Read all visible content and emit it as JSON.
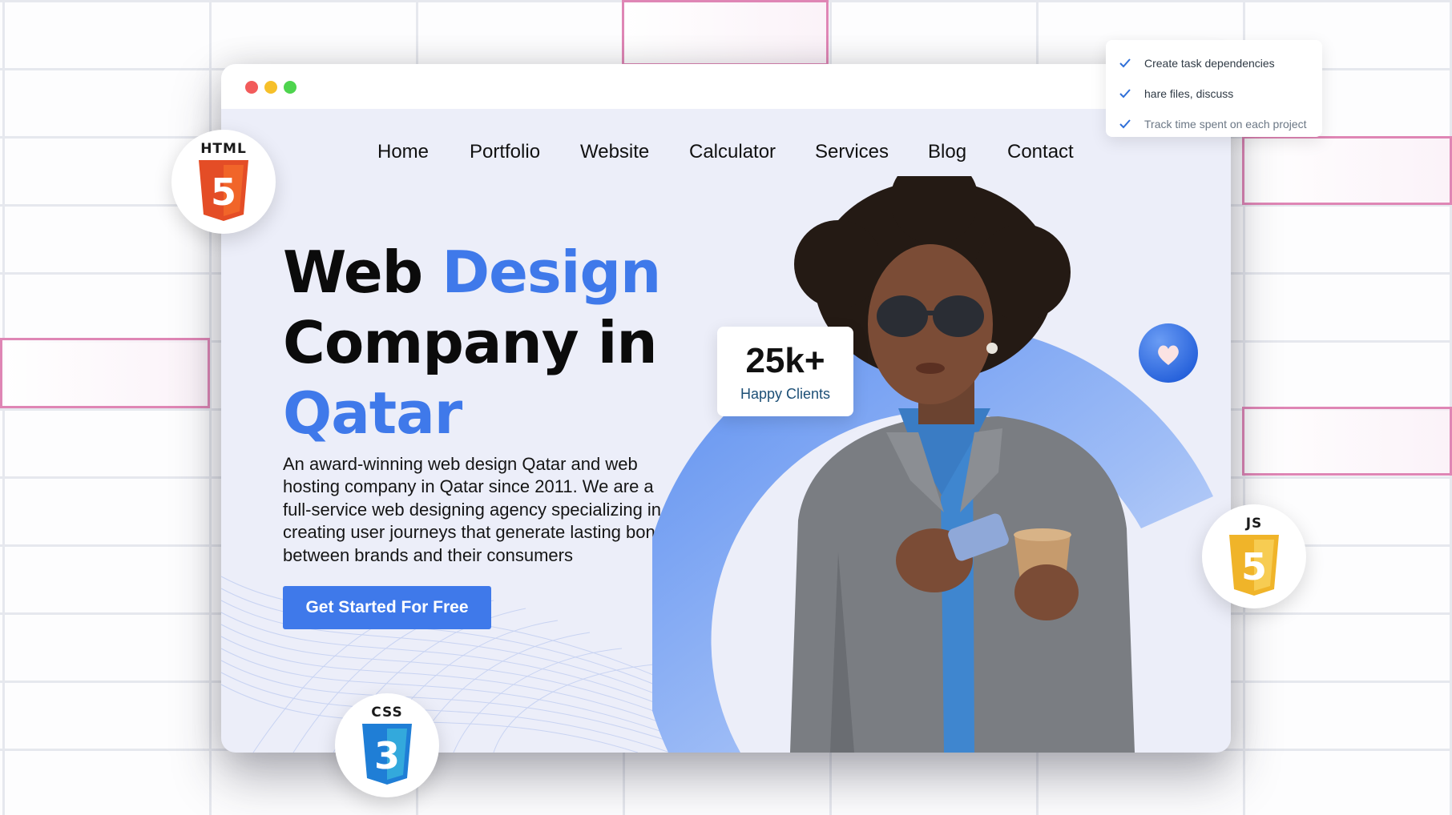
{
  "checklist": {
    "items": [
      {
        "label": "Create task dependencies"
      },
      {
        "label": "hare files, discuss"
      },
      {
        "label": "Track time spent on each project"
      }
    ]
  },
  "nav": {
    "items": [
      {
        "label": "Home"
      },
      {
        "label": "Portfolio"
      },
      {
        "label": "Website"
      },
      {
        "label": "Calculator"
      },
      {
        "label": "Services"
      },
      {
        "label": "Blog"
      },
      {
        "label": "Contact"
      }
    ]
  },
  "hero": {
    "title_word1": "Web",
    "title_word2": "Design",
    "title_line2": "Company in",
    "title_line3": "Qatar",
    "description": "An award-winning web design Qatar and web hosting company in Qatar since 2011. We are a full-service web designing agency specializing in creating user journeys that generate lasting bonds between brands and their consumers",
    "cta_label": "Get Started For Free"
  },
  "stat": {
    "value": "25k+",
    "label": "Happy Clients"
  },
  "badges": {
    "html": {
      "label": "HTML",
      "number": "5",
      "icon": "html5-shield-icon"
    },
    "css": {
      "label": "CSS",
      "number": "3",
      "icon": "css3-shield-icon"
    },
    "js": {
      "label": "JS",
      "number": "5",
      "icon": "js-shield-icon"
    }
  },
  "colors": {
    "accent": "#3f79ea",
    "html_orange": "#e44d26",
    "css_blue": "#1f7ed6",
    "js_yellow": "#f0b429",
    "check_blue": "#2f6fd8",
    "highlight_pink": "#df86b5"
  }
}
